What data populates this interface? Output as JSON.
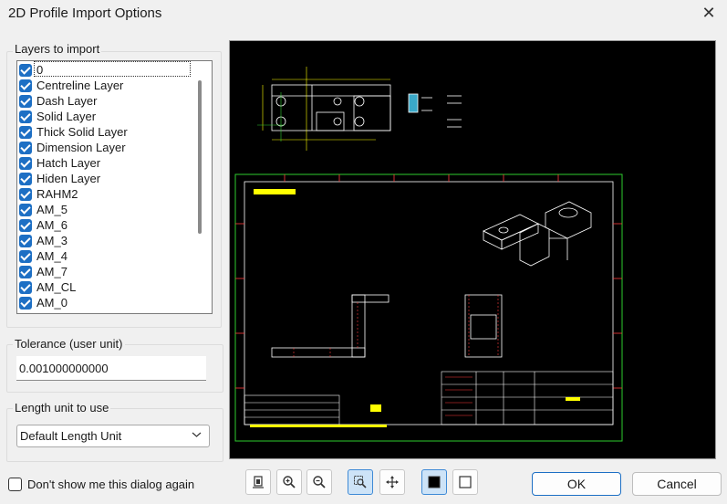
{
  "window": {
    "title": "2D Profile Import Options",
    "close_icon": "close-icon"
  },
  "layers": {
    "group_label": "Layers to import",
    "items": [
      {
        "label": "0",
        "checked": true
      },
      {
        "label": "Centreline Layer",
        "checked": true
      },
      {
        "label": "Dash Layer",
        "checked": true
      },
      {
        "label": "Solid Layer",
        "checked": true
      },
      {
        "label": "Thick Solid Layer",
        "checked": true
      },
      {
        "label": "Dimension Layer",
        "checked": true
      },
      {
        "label": "Hatch Layer",
        "checked": true
      },
      {
        "label": "Hiden Layer",
        "checked": true
      },
      {
        "label": "RAHM2",
        "checked": true
      },
      {
        "label": "AM_5",
        "checked": true
      },
      {
        "label": "AM_6",
        "checked": true
      },
      {
        "label": "AM_3",
        "checked": true
      },
      {
        "label": "AM_4",
        "checked": true
      },
      {
        "label": "AM_7",
        "checked": true
      },
      {
        "label": "AM_CL",
        "checked": true
      },
      {
        "label": "AM_0",
        "checked": true
      }
    ]
  },
  "tolerance": {
    "group_label": "Tolerance (user unit)",
    "value": "0.001000000000"
  },
  "length_unit": {
    "group_label": "Length unit to use",
    "selected": "Default Length Unit"
  },
  "dont_show": {
    "label": "Don't show me this dialog again",
    "checked": false
  },
  "preview": {
    "background": "#000000",
    "frame_color": "#2ecc2e",
    "line_color": "#ffffff",
    "dim_color": "#ffff00"
  },
  "toolbar": {
    "icons": [
      "fit-to-page-icon",
      "zoom-in-icon",
      "zoom-out-icon",
      "zoom-window-icon",
      "pan-icon",
      "black-background-icon",
      "white-background-icon"
    ]
  },
  "buttons": {
    "ok": "OK",
    "cancel": "Cancel"
  },
  "colors": {
    "accent": "#1d6fc4"
  }
}
